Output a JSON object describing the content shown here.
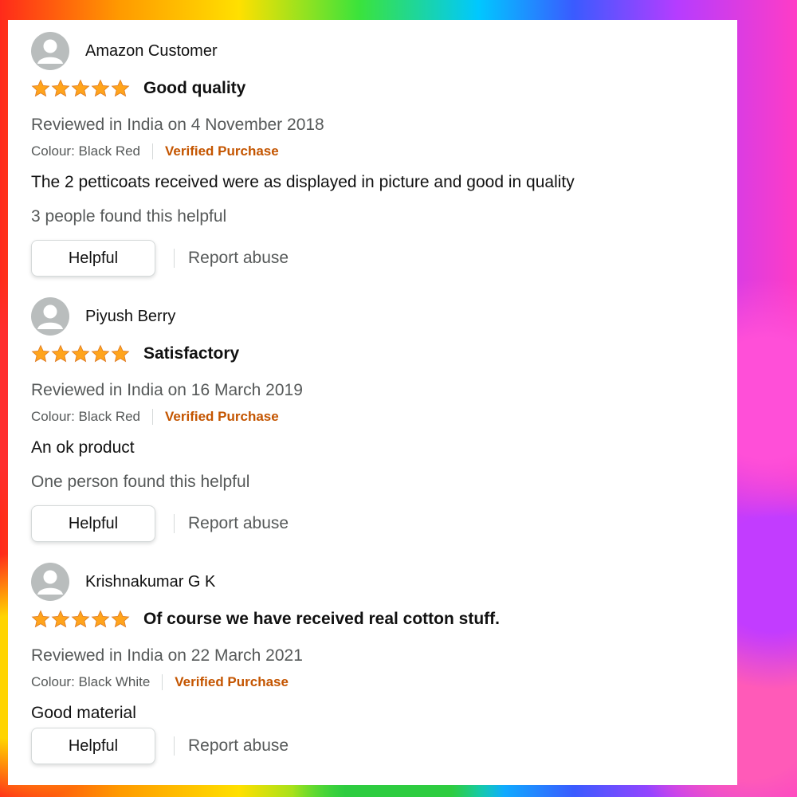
{
  "reviews": [
    {
      "reviewer": "Amazon Customer",
      "rating": 5,
      "max_rating": 5,
      "title": "Good quality",
      "date": "Reviewed in India on 4 November 2018",
      "colour": "Colour: Black Red",
      "verified": "Verified Purchase",
      "body": "The 2 petticoats received were as displayed in picture and good in quality",
      "helpful_count": "3 people found this helpful",
      "helpful_label": "Helpful",
      "report_label": "Report abuse"
    },
    {
      "reviewer": "Piyush Berry",
      "rating": 5,
      "max_rating": 5,
      "title": "Satisfactory",
      "date": "Reviewed in India on 16 March 2019",
      "colour": "Colour: Black Red",
      "verified": "Verified Purchase",
      "body": "An ok product",
      "helpful_count": "One person found this helpful",
      "helpful_label": "Helpful",
      "report_label": "Report abuse"
    },
    {
      "reviewer": "Krishnakumar G K",
      "rating": 5,
      "max_rating": 5,
      "title": "Of course we have received real cotton stuff.",
      "date": "Reviewed in India on 22 March 2021",
      "colour": "Colour: Black White",
      "verified": "Verified Purchase",
      "body": "Good material",
      "helpful_label": "Helpful",
      "report_label": "Report abuse"
    }
  ],
  "colors": {
    "star": "#ffa41c",
    "verified": "#c45500",
    "text_secondary": "#565959",
    "text_primary": "#111111"
  },
  "icons": {
    "avatar": "default-user-avatar-icon",
    "star": "star-icon"
  }
}
